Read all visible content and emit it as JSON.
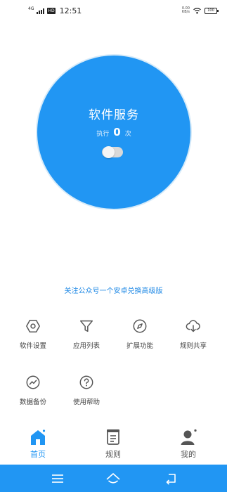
{
  "status_bar": {
    "network": "4G",
    "hd": "HD",
    "time": "12:51",
    "speed_value": "0.00",
    "speed_unit": "KB/s",
    "battery": "100"
  },
  "main": {
    "title": "软件服务",
    "count_prefix": "执行",
    "count_value": "0",
    "count_suffix": "次",
    "toggle_on": false
  },
  "promo_text": "关注公众号一个安卓兑换高级版",
  "grid": [
    {
      "label": "软件设置",
      "icon": "gear-hex-icon"
    },
    {
      "label": "应用列表",
      "icon": "funnel-icon"
    },
    {
      "label": "扩展功能",
      "icon": "compass-icon"
    },
    {
      "label": "规则共享",
      "icon": "cloud-download-icon"
    },
    {
      "label": "数据备份",
      "icon": "chart-circle-icon"
    },
    {
      "label": "使用帮助",
      "icon": "help-circle-icon"
    }
  ],
  "tabs": [
    {
      "label": "首页",
      "icon": "home-icon",
      "active": true
    },
    {
      "label": "规则",
      "icon": "rules-icon",
      "active": false
    },
    {
      "label": "我的",
      "icon": "profile-icon",
      "active": false
    }
  ],
  "colors": {
    "accent": "#2196f3",
    "promo": "#1e88e5",
    "icon": "#555555"
  }
}
